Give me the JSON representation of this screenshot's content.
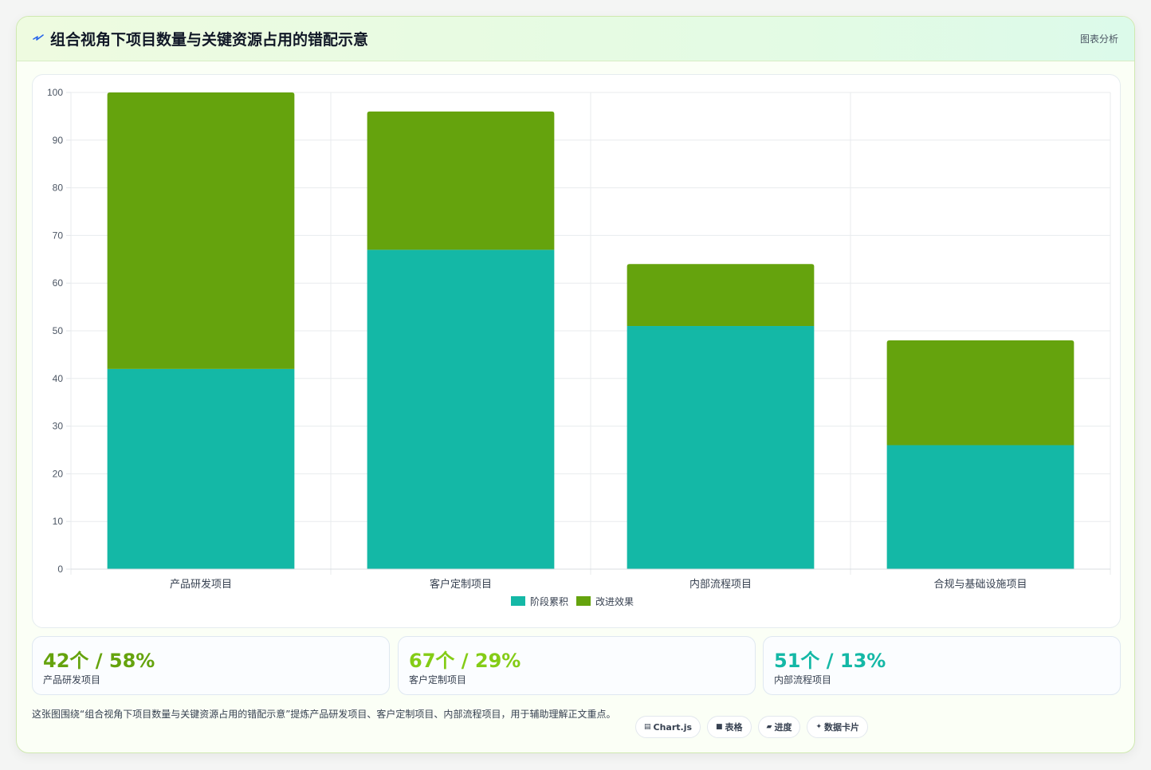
{
  "header": {
    "title": "组合视角下项目数量与关键资源占用的错配示意",
    "tag": "图表分析"
  },
  "colors": {
    "teal": "#14b8a6",
    "green": "#65a30d",
    "light_green": "#84cc16"
  },
  "chart_data": {
    "type": "bar",
    "stacked": true,
    "categories": [
      "产品研发项目",
      "客户定制项目",
      "内部流程项目",
      "合规与基础设施项目"
    ],
    "series": [
      {
        "name": "阶段累积",
        "color": "#14b8a6",
        "values": [
          42,
          67,
          51,
          26
        ]
      },
      {
        "name": "改进效果",
        "color": "#65a30d",
        "values": [
          58,
          29,
          13,
          22
        ]
      }
    ],
    "ylim": [
      0,
      100
    ],
    "yticks": [
      0,
      10,
      20,
      30,
      40,
      50,
      60,
      70,
      80,
      90,
      100
    ],
    "grid": true,
    "legend_position": "bottom"
  },
  "stats": [
    {
      "value": "42个 / 58%",
      "label": "产品研发项目",
      "color": "#65a30d"
    },
    {
      "value": "67个 / 29%",
      "label": "客户定制项目",
      "color": "#84cc16"
    },
    {
      "value": "51个 / 13%",
      "label": "内部流程项目",
      "color": "#14b8a6"
    }
  ],
  "description": "这张图围绕“组合视角下项目数量与关键资源占用的错配示意”提炼产品研发项目、客户定制项目、内部流程项目，用于辅助理解正文重点。",
  "chips": [
    {
      "icon": "▤",
      "label": "Chart.js"
    },
    {
      "icon": "■",
      "label": "表格"
    },
    {
      "icon": "▰",
      "label": "进度"
    },
    {
      "icon": "✦",
      "label": "数据卡片"
    }
  ]
}
